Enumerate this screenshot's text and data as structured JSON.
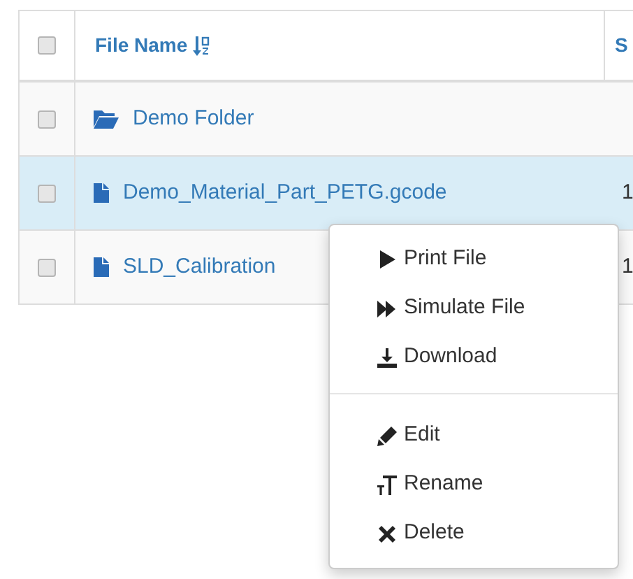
{
  "table": {
    "select_all": {
      "checked": false
    },
    "columns": [
      {
        "label": "File Name",
        "sorted": true
      },
      {
        "label": "S"
      }
    ],
    "rows": [
      {
        "kind": "folder",
        "name": "Demo Folder",
        "checked": false,
        "selected": false
      },
      {
        "kind": "file",
        "name": "Demo_Material_Part_PETG.gcode",
        "column_2": "1",
        "checked": false,
        "selected": true
      },
      {
        "kind": "file",
        "name": "SLD_Calibration",
        "column_2": "1",
        "checked": false,
        "selected": false
      }
    ]
  },
  "context_menu": {
    "groups": [
      [
        {
          "kind": "print",
          "label": "Print File"
        },
        {
          "kind": "simulate",
          "label": "Simulate File"
        },
        {
          "kind": "download",
          "label": "Download"
        }
      ],
      [
        {
          "kind": "edit",
          "label": "Edit"
        },
        {
          "kind": "rename",
          "label": "Rename"
        },
        {
          "kind": "delete",
          "label": "Delete"
        }
      ]
    ]
  }
}
